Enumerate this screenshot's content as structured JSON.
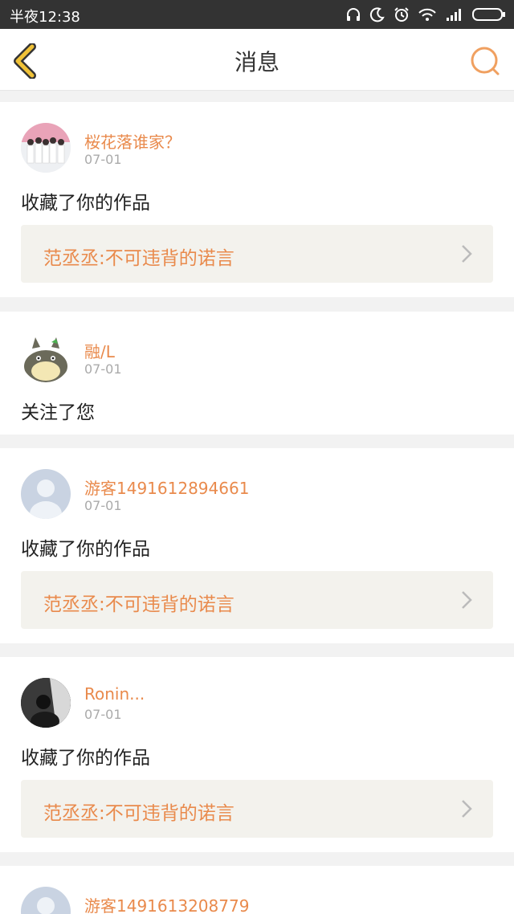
{
  "status_bar": {
    "time": "半夜12:38",
    "icons": [
      "headphones-icon",
      "moon-icon",
      "alarm-icon",
      "wifi-icon",
      "signal-icon",
      "battery-icon"
    ]
  },
  "header": {
    "title": "消息",
    "back_icon": "chevron-left-icon",
    "search_icon": "search-icon"
  },
  "colors": {
    "accent": "#e98a4c",
    "back_icon": "#f0c238",
    "status_bar": "#333333",
    "link_bg": "#f3f2ed"
  },
  "messages": [
    {
      "user": "桜花落谁家？",
      "date": "07-01",
      "text": "收藏了你的作品",
      "work": "范丞丞:不可违背的诺言",
      "avatar": "group-photo-avatar"
    },
    {
      "user": "融/L",
      "date": "07-01",
      "text": "关注了您",
      "avatar": "totoro-avatar"
    },
    {
      "user": "游客1491612894661",
      "date": "07-01",
      "text": "收藏了你的作品",
      "work": "范丞丞:不可违背的诺言",
      "avatar": "default-user-avatar"
    },
    {
      "user": "Ronin...",
      "date": "07-01",
      "text": "收藏了你的作品",
      "work": "范丞丞:不可违背的诺言",
      "avatar": "dark-photo-avatar"
    },
    {
      "user": "游客1491613208779",
      "avatar": "default-user-avatar"
    }
  ]
}
